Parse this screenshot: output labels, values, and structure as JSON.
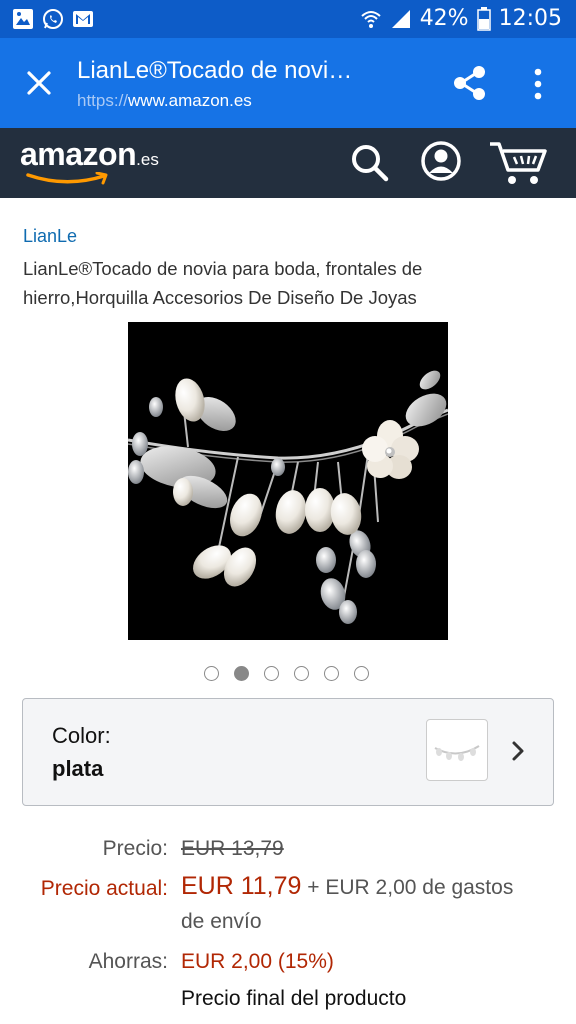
{
  "status_bar": {
    "battery": "42%",
    "time": "12:05"
  },
  "browser": {
    "page_title": "LianLe®Tocado de novi…",
    "url_scheme": "https://",
    "url_host": "www.amazon.es"
  },
  "amazon_header": {
    "logo_word": "amazon",
    "logo_tld": ".es"
  },
  "product": {
    "brand": "LianLe",
    "title": "LianLe®Tocado de novia para boda, frontales de hierro,Horquilla Accesorios De Diseño De Joyas",
    "image_dots": 6,
    "active_dot": 2
  },
  "variation": {
    "label": "Color:",
    "value": "plata"
  },
  "pricing": {
    "list_price_label": "Precio:",
    "list_price": "EUR 13,79",
    "current_price_label": "Precio actual:",
    "current_price": "EUR 11,79",
    "shipping_line1": "+ EUR 2,00 de gastos",
    "shipping_line2": "de envío",
    "savings_label": "Ahorras:",
    "savings": "EUR 2,00 (15%)",
    "final_price_note": "Precio final del producto"
  },
  "colors": {
    "status_bar": "#0d5cc8",
    "browser_bar": "#1673e6",
    "amazon_bar": "#232f3e",
    "amazon_orange": "#ff9900",
    "price_red": "#b12704",
    "link_blue": "#0f6bb0"
  }
}
